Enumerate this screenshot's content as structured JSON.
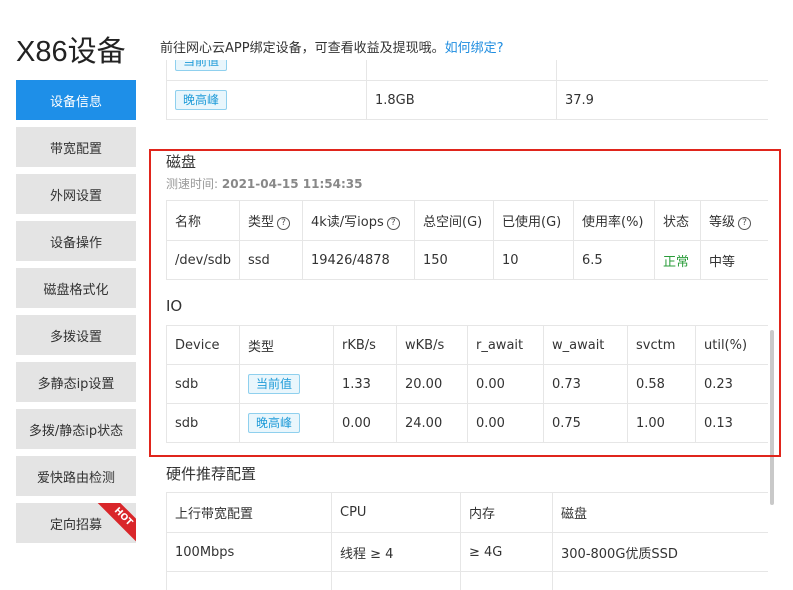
{
  "header": {
    "title": "X86设备",
    "description": "前往网心云APP绑定设备，可查看收益及提现哦。",
    "bind_link": "如何绑定?"
  },
  "sidebar": {
    "items": [
      {
        "label": "设备信息",
        "active": true
      },
      {
        "label": "带宽配置"
      },
      {
        "label": "外网设置"
      },
      {
        "label": "设备操作"
      },
      {
        "label": "磁盘格式化"
      },
      {
        "label": "多拨设置"
      },
      {
        "label": "多静态ip设置"
      },
      {
        "label": "多拨/静态ip状态"
      },
      {
        "label": "爱快路由检测"
      },
      {
        "label": "定向招募",
        "badge": "HOT"
      }
    ]
  },
  "top_table": {
    "rows": [
      {
        "tag": "当前值",
        "memory": "",
        "cpu": ""
      },
      {
        "tag": "晚高峰",
        "memory": "1.8GB",
        "cpu": "37.9"
      }
    ]
  },
  "disk": {
    "title": "磁盘",
    "test_time_label": "测速时间:",
    "test_time": "2021-04-15 11:54:35",
    "columns": [
      "名称",
      "类型",
      "4k读/写iops",
      "总空间(G)",
      "已使用(G)",
      "使用率(%)",
      "状态",
      "等级"
    ],
    "help_icon": "?",
    "rows": [
      {
        "name": "/dev/sdb",
        "type": "ssd",
        "iops": "19426/4878",
        "total": "150",
        "used": "10",
        "usage": "6.5",
        "status": "正常",
        "level": "中等"
      }
    ]
  },
  "io": {
    "title": "IO",
    "columns": [
      "Device",
      "类型",
      "rKB/s",
      "wKB/s",
      "r_await",
      "w_await",
      "svctm",
      "util(%)"
    ],
    "rows": [
      {
        "device": "sdb",
        "type": "当前值",
        "rkb": "1.33",
        "wkb": "20.00",
        "r_await": "0.00",
        "w_await": "0.73",
        "svctm": "0.58",
        "util": "0.23"
      },
      {
        "device": "sdb",
        "type": "晚高峰",
        "rkb": "0.00",
        "wkb": "24.00",
        "r_await": "0.00",
        "w_await": "0.75",
        "svctm": "1.00",
        "util": "0.13"
      }
    ]
  },
  "hardware": {
    "title": "硬件推荐配置",
    "columns": [
      "上行带宽配置",
      "CPU",
      "内存",
      "磁盘"
    ],
    "rows": [
      {
        "bandwidth": "100Mbps",
        "cpu": "线程 ≥ 4",
        "memory": "≥ 4G",
        "disk": "300-800G优质SSD"
      }
    ]
  },
  "colors": {
    "accent": "#1e8fe8",
    "highlight": "#e0251c",
    "ok": "#2a9c3a",
    "hot": "#d9262a"
  }
}
